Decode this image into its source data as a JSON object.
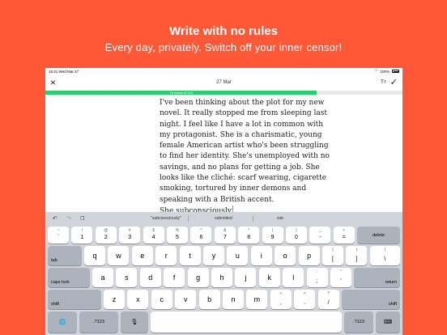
{
  "hero": {
    "title": "Write with no rules",
    "subtitle": "Every day, privately. Switch off your inner censor!"
  },
  "status_bar": {
    "time": "15:31",
    "date": "Wed Mar 27",
    "battery": "100%"
  },
  "nav": {
    "close_icon": "×",
    "date": "27 Mar",
    "font_size_label": "Tт",
    "done_icon": "✓"
  },
  "progress": {
    "label": "76 words of 100",
    "words": 76,
    "goal": 100,
    "color": "#2ECC71"
  },
  "editor": {
    "text": "I've been thinking about the plot for my new novel. It really stopped me from sleeping last night. I feel like I have a lot in common with my protagonist. She is a charismatic, young female American artist who's been struggling to find her identity. She's unemployed with no savings, and no plans for getting a job. She looks like the cliché: scarf wearing, cigarette smoking, tortured by inner demons and speaking with a British accent.\nShe subconsciously"
  },
  "keyboard": {
    "toolbar": {
      "undo_icon": "↶",
      "redo_icon": "↷",
      "paste_icon": "❐",
      "suggestions": [
        "\"subconsciously\"",
        "submitted",
        "sub"
      ]
    },
    "row1": [
      {
        "alt": "~",
        "main": "`"
      },
      {
        "alt": "!",
        "main": "1"
      },
      {
        "alt": "@",
        "main": "2"
      },
      {
        "alt": "#",
        "main": "3"
      },
      {
        "alt": "$",
        "main": "4"
      },
      {
        "alt": "%",
        "main": "5"
      },
      {
        "alt": "^",
        "main": "6"
      },
      {
        "alt": "&",
        "main": "7"
      },
      {
        "alt": "*",
        "main": "8"
      },
      {
        "alt": "(",
        "main": "9"
      },
      {
        "alt": ")",
        "main": "0"
      },
      {
        "alt": "_",
        "main": "-"
      },
      {
        "alt": "+",
        "main": "="
      }
    ],
    "delete_label": "delete",
    "tab_label": "tab",
    "row2": [
      "q",
      "w",
      "e",
      "r",
      "t",
      "y",
      "u",
      "i",
      "o",
      "p"
    ],
    "row2_punct": [
      {
        "alt": "{",
        "main": "["
      },
      {
        "alt": "}",
        "main": "]"
      },
      {
        "alt": "|",
        "main": "\\"
      }
    ],
    "caps_label": "caps lock",
    "row3": [
      "a",
      "s",
      "d",
      "f",
      "g",
      "h",
      "j",
      "k",
      "l"
    ],
    "row3_punct": [
      {
        "alt": ":",
        "main": ";"
      },
      {
        "alt": "\"",
        "main": "'"
      }
    ],
    "return_label": "return",
    "shift_label": "shift",
    "row4": [
      "z",
      "x",
      "c",
      "v",
      "b",
      "n",
      "m"
    ],
    "row4_punct": [
      {
        "alt": "<",
        "main": ","
      },
      {
        "alt": ">",
        "main": "."
      },
      {
        "alt": "?",
        "main": "/"
      }
    ],
    "globe_icon": "🌐",
    "num_label": ".?123",
    "mic_icon": "🎙",
    "hide_icon": "⌨"
  }
}
